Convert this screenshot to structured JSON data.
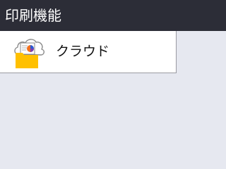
{
  "header": {
    "title": "印刷機能"
  },
  "menu": {
    "items": [
      {
        "label": "クラウド",
        "icon": "cloud-print-icon"
      }
    ]
  },
  "colors": {
    "header_bg": "#2c2d37",
    "header_text": "#ffffff",
    "body_bg": "#e6e8f0",
    "item_bg": "#ffffff",
    "folder": "#ffc000"
  }
}
